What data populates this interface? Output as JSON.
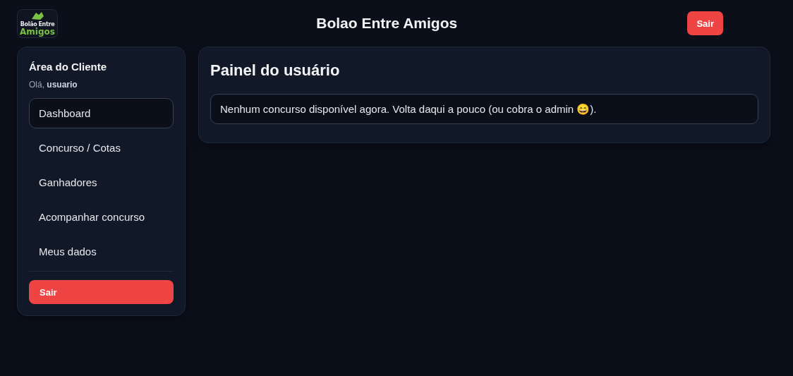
{
  "header": {
    "logo": {
      "line_1_left": "Bolão",
      "line_1_right": "Entre",
      "line_2": "Amigos"
    },
    "title": "Bolao Entre Amigos",
    "logout_button": "Sair"
  },
  "sidebar": {
    "title": "Área do Cliente",
    "greeting": "Olá, **usuario**",
    "items": [
      {
        "label": "Dashboard",
        "selected": true
      },
      {
        "label": "Concurso / Cotas",
        "selected": false
      },
      {
        "label": "Ganhadores",
        "selected": false
      },
      {
        "label": "Acompanhar concurso",
        "selected": false
      },
      {
        "label": "Meus dados",
        "selected": false
      }
    ],
    "logout_button": "Sair"
  },
  "panel": {
    "title": "Painel do usuário",
    "message": "Nenhum concurso disponível agora. Volta daqui a pouco (ou cobra o admin 😄)."
  }
}
